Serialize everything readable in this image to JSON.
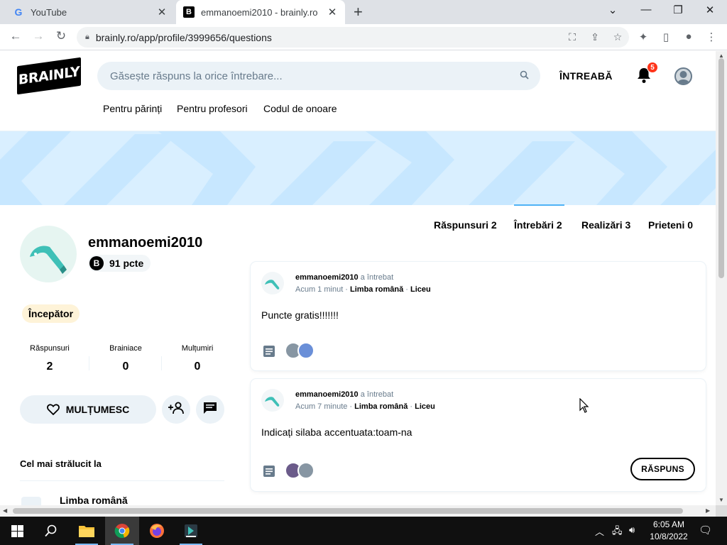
{
  "browser": {
    "tabs": [
      {
        "title": "YouTube",
        "favicon": "google-icon"
      },
      {
        "title": "emmanoemi2010 - brainly.ro",
        "favicon": "brainly-icon"
      }
    ],
    "url": "brainly.ro/app/profile/3999656/questions"
  },
  "header": {
    "logo": "BRAINLY",
    "search_placeholder": "Găsește răspuns la orice întrebare...",
    "ask_label": "ÎNTREABĂ",
    "notification_count": "5",
    "subnav": [
      "Pentru părinți",
      "Pentru profesori",
      "Codul de onoare"
    ]
  },
  "profile": {
    "username": "emmanoemi2010",
    "points": "91 pcte",
    "rank": "Începător",
    "stats": [
      {
        "label": "Răspunsuri",
        "value": "2"
      },
      {
        "label": "Brainiace",
        "value": "0"
      },
      {
        "label": "Mulțumiri",
        "value": "0"
      }
    ],
    "thanks_label": "MULȚUMESC",
    "best_in_title": "Cel mai strălucit la",
    "best_subject": "Limba română"
  },
  "profile_tabs": [
    "Răspunsuri 2",
    "Întrebări 2",
    "Realizări 3",
    "Prieteni 0"
  ],
  "active_tab_index": 1,
  "questions": [
    {
      "author": "emmanoemi2010",
      "action": "a întrebat",
      "time": "Acum 1 minut",
      "subject": "Limba română",
      "level": "Liceu",
      "text": "Puncte gratis!!!!!!!"
    },
    {
      "author": "emmanoemi2010",
      "action": "a întrebat",
      "time": "Acum 7 minute",
      "subject": "Limba română",
      "level": "Liceu",
      "text": "Indicați silaba accentuata:toam-na",
      "answer_label": "RĂSPUNS"
    }
  ],
  "taskbar": {
    "time": "6:05 AM",
    "date": "10/8/2022"
  },
  "colors": {
    "banner": "#d9efff",
    "search_bg": "#ebf2f7",
    "badge": "#ff341a",
    "tab_underline": "#4fb3f6",
    "rank_bg": "#fef3d8"
  }
}
